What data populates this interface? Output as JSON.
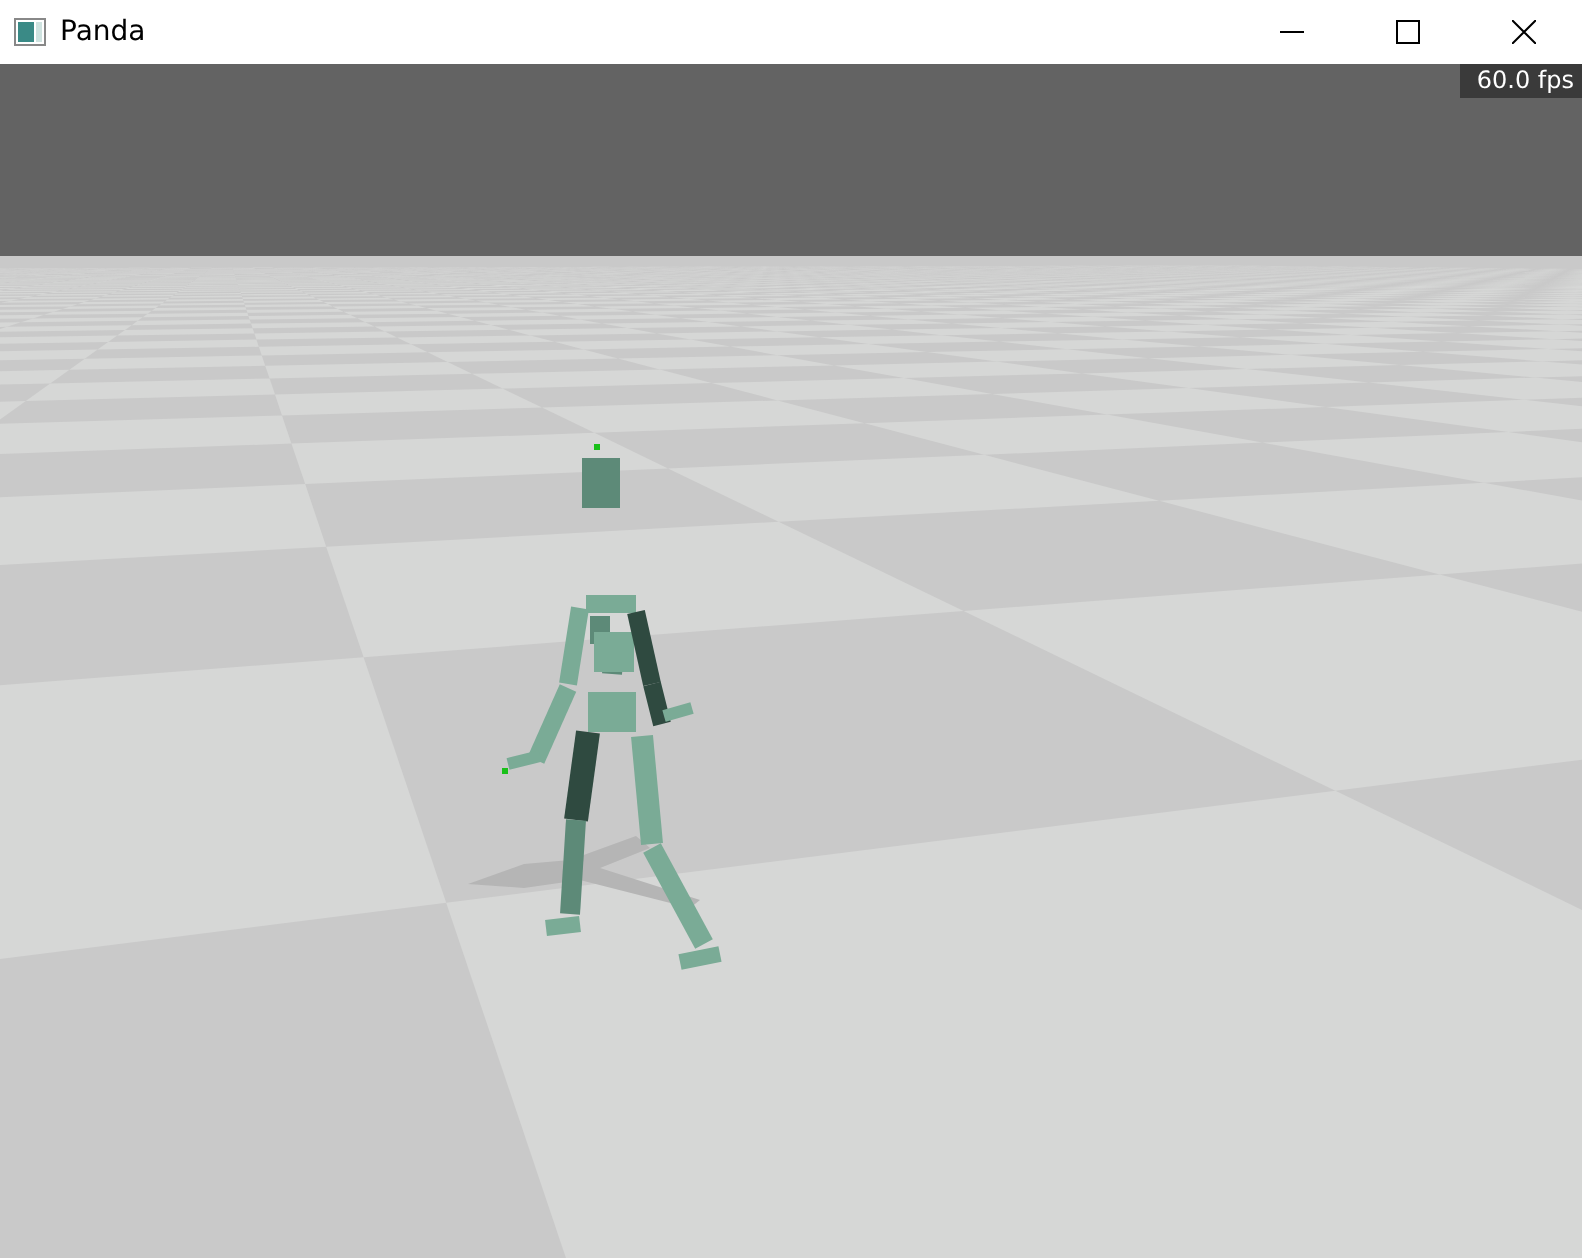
{
  "window": {
    "title": "Panda"
  },
  "viewport": {
    "fps": "60.0 fps"
  }
}
